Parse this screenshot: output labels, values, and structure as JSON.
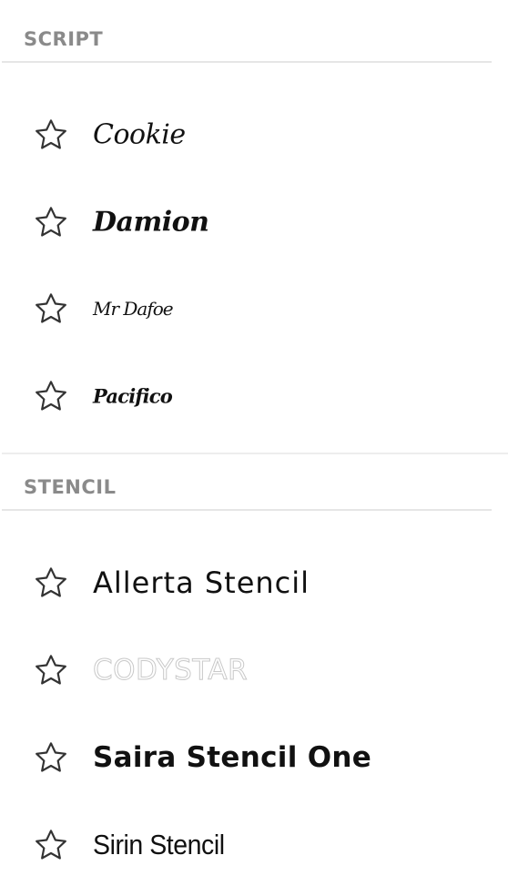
{
  "sections": [
    {
      "title": "SCRIPT",
      "fonts": [
        {
          "name": "Cookie",
          "favorite": false,
          "icon": "star-outline-icon"
        },
        {
          "name": "Damion",
          "favorite": false,
          "icon": "star-outline-icon"
        },
        {
          "name": "Mr Dafoe",
          "favorite": false,
          "icon": "star-outline-icon"
        },
        {
          "name": "Pacifico",
          "favorite": false,
          "icon": "star-outline-icon"
        }
      ]
    },
    {
      "title": "STENCIL",
      "fonts": [
        {
          "name": "Allerta Stencil",
          "favorite": false,
          "icon": "star-outline-icon"
        },
        {
          "name": "CODYSTAR",
          "favorite": false,
          "icon": "star-outline-icon"
        },
        {
          "name": "Saira Stencil One",
          "favorite": false,
          "icon": "star-outline-icon"
        },
        {
          "name": "Sirin Stencil",
          "favorite": false,
          "icon": "star-outline-icon"
        }
      ]
    }
  ],
  "colors": {
    "header_text": "#8a8a8a",
    "divider": "#e6e6e6",
    "font_text": "#111111",
    "icon_stroke": "#333333",
    "codystar_outline": "#c9c9c9"
  }
}
